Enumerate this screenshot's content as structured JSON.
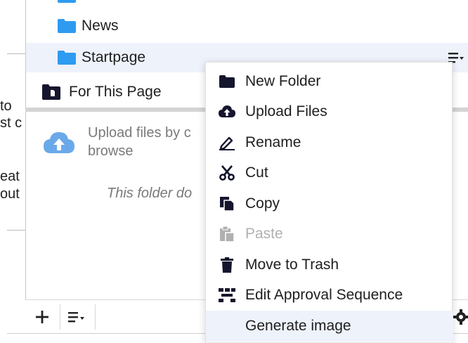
{
  "background_page": {
    "lines": [
      {
        "text": "to"
      },
      {
        "text": "st c"
      },
      {
        "text": "eat"
      },
      {
        "text": "out"
      }
    ]
  },
  "tree": {
    "items": [
      {
        "label": "News",
        "icon": "folder-icon"
      },
      {
        "label": "Startpage",
        "icon": "folder-icon",
        "selected": true
      },
      {
        "label": "For This Page",
        "icon": "page-folder-icon"
      }
    ]
  },
  "upload": {
    "text_line1": "Upload files by c",
    "text_line2": "browse",
    "icon": "cloud-upload-icon"
  },
  "empty_state": {
    "text": "This folder do"
  },
  "toolbar": {
    "add_icon": "plus-icon",
    "sort_icon": "list-sort-icon"
  },
  "context_menu": {
    "items": [
      {
        "label": "New Folder",
        "icon": "folder-icon",
        "disabled": false
      },
      {
        "label": "Upload Files",
        "icon": "cloud-upload-icon",
        "disabled": false
      },
      {
        "label": "Rename",
        "icon": "rename-icon",
        "disabled": false
      },
      {
        "label": "Cut",
        "icon": "scissors-icon",
        "disabled": false
      },
      {
        "label": "Copy",
        "icon": "copy-icon",
        "disabled": false
      },
      {
        "label": "Paste",
        "icon": "paste-icon",
        "disabled": true
      },
      {
        "label": "Move to Trash",
        "icon": "trash-icon",
        "disabled": false
      },
      {
        "label": "Edit Approval Sequence",
        "icon": "approval-sequence-icon",
        "disabled": false
      },
      {
        "label": "Generate image",
        "icon": "",
        "disabled": false,
        "hovered": true
      }
    ]
  },
  "colors": {
    "folder_blue": "#2e9bf0",
    "selection_bg": "#eef2fb",
    "menu_icon_dark": "#15152e",
    "disabled_grey": "#b0b0b0",
    "cloud_blue": "#6aa9e9"
  }
}
